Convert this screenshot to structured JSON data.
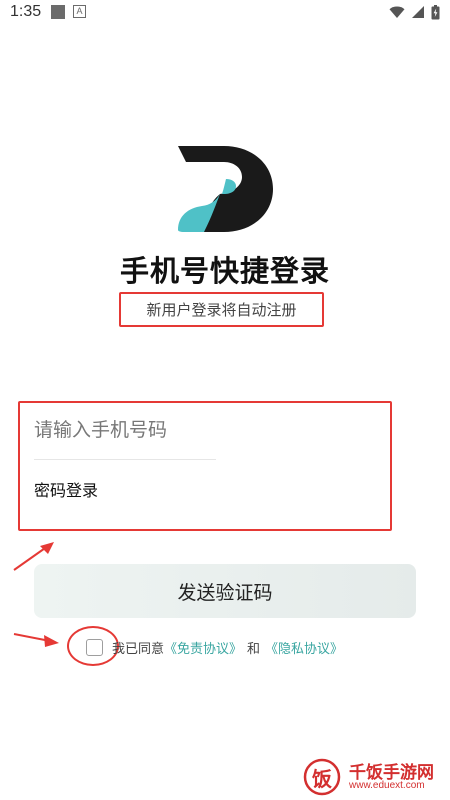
{
  "status_bar": {
    "time": "1:35",
    "notification_a": "A",
    "icons": [
      "wifi-icon",
      "cell-signal-icon",
      "battery-icon"
    ]
  },
  "app": {
    "logo": "D",
    "title": "手机号快捷登录",
    "subtitle": "新用户登录将自动注册"
  },
  "form": {
    "phone_placeholder": "请输入手机号码",
    "phone_value": "",
    "password_login_label": "密码登录"
  },
  "send_button_label": "发送验证码",
  "agreement": {
    "checked": false,
    "prefix": "我已同意",
    "terms_link": "《免责协议》",
    "and": "和",
    "privacy_link": "《隐私协议》"
  },
  "watermark": {
    "badge": "饭",
    "title": "千饭手游网",
    "url": "www.eduext.com"
  },
  "colors": {
    "annotation_red": "#e53935",
    "link_teal": "#3aa6a1",
    "logo_dark": "#1a1a1a",
    "logo_teal": "#4fc1c7",
    "button_bg": "#eaf0ee"
  }
}
